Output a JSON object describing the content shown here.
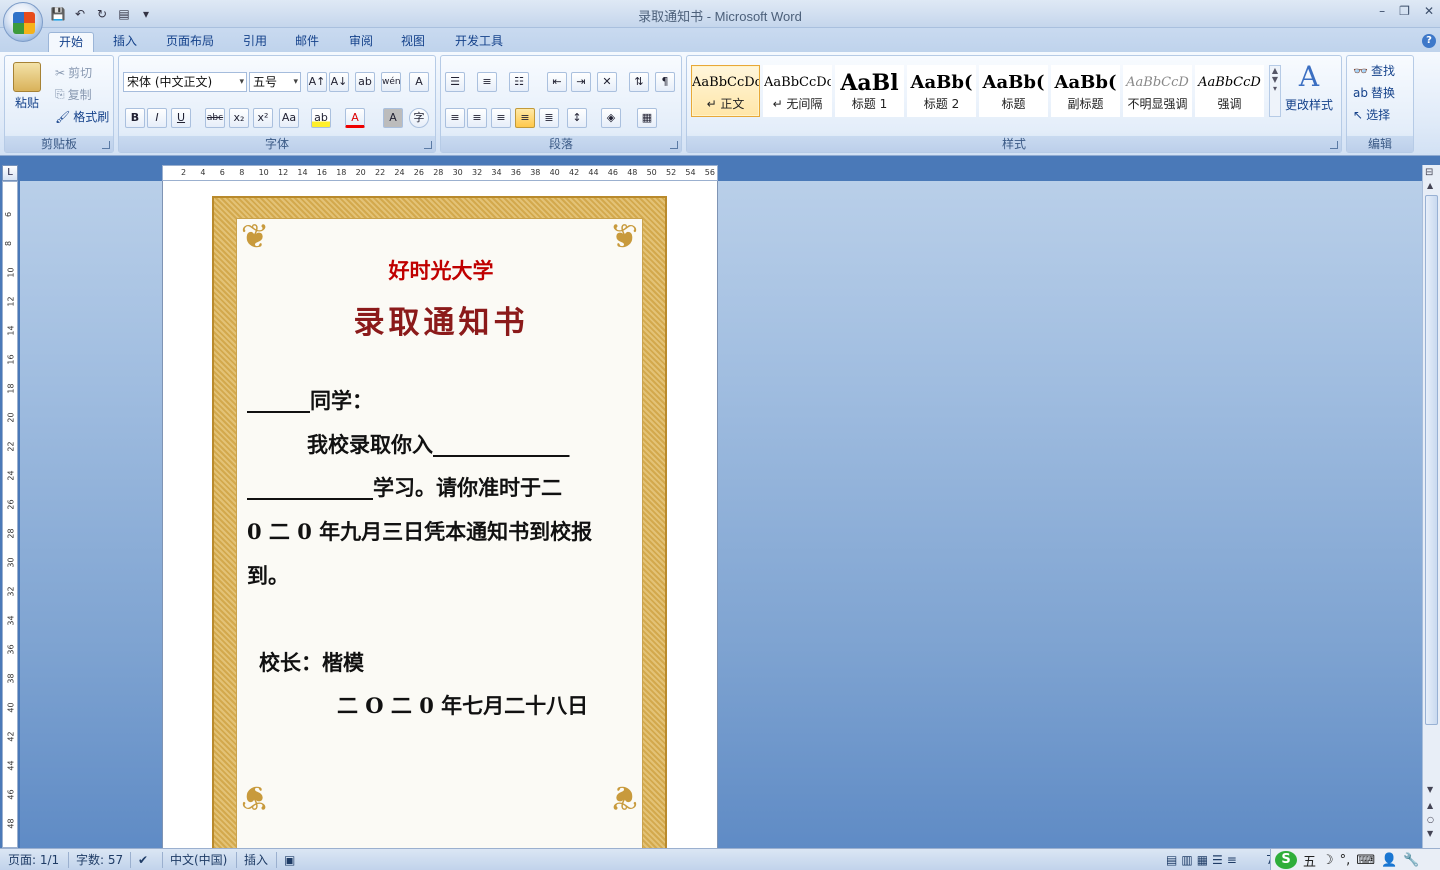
{
  "window": {
    "title": "录取通知书 - Microsoft Word",
    "minimize": "–",
    "restore": "❐",
    "close": "✕"
  },
  "tabs": [
    {
      "label": "开始",
      "active": true
    },
    {
      "label": "插入"
    },
    {
      "label": "页面布局"
    },
    {
      "label": "引用"
    },
    {
      "label": "邮件"
    },
    {
      "label": "审阅"
    },
    {
      "label": "视图"
    },
    {
      "label": "开发工具"
    }
  ],
  "help_label": "?",
  "clipboard": {
    "group": "剪贴板",
    "paste": "粘贴",
    "cut": "剪切",
    "copy": "复制",
    "format_painter": "格式刷"
  },
  "font": {
    "group": "字体",
    "name": "宋体 (中文正文)",
    "size": "五号",
    "bold": "B",
    "italic": "I",
    "underline": "U",
    "strike": "abc",
    "sub": "x₂",
    "sup": "x²",
    "case": "Aa",
    "grow": "A↑",
    "shrink": "A↓",
    "clear": "ab",
    "phonetic": "wén",
    "border": "A",
    "highlight": "ab",
    "color": "A",
    "shade": "A",
    "enclose": "字"
  },
  "paragraph": {
    "group": "段落"
  },
  "styles": {
    "group": "样式",
    "items": [
      {
        "sample": "AaBbCcDc",
        "name": "↵ 正文",
        "selected": true
      },
      {
        "sample": "AaBbCcDc",
        "name": "↵ 无间隔"
      },
      {
        "sample": "AaBl",
        "name": "标题 1"
      },
      {
        "sample": "AaBb(",
        "name": "标题 2"
      },
      {
        "sample": "AaBb(",
        "name": "标题"
      },
      {
        "sample": "AaBb(",
        "name": "副标题"
      },
      {
        "sample": "AaBbCcD",
        "name": "不明显强调"
      },
      {
        "sample": "AaBbCcD",
        "name": "强调"
      }
    ],
    "change": "更改样式"
  },
  "editing": {
    "group": "编辑",
    "find": "查找",
    "replace": "替换",
    "select": "选择"
  },
  "ruler": {
    "h_ticks": [
      "2",
      "4",
      "6",
      "8",
      "10",
      "12",
      "14",
      "16",
      "18",
      "20",
      "22",
      "24",
      "26",
      "28",
      "30",
      "32",
      "34",
      "36",
      "38",
      "40",
      "42",
      "44",
      "46",
      "48",
      "50",
      "52",
      "54",
      "56"
    ],
    "v_ticks": [
      "6",
      "8",
      "10",
      "12",
      "14",
      "16",
      "18",
      "20",
      "22",
      "24",
      "26",
      "28",
      "30",
      "32",
      "34",
      "36",
      "38",
      "40",
      "42",
      "44",
      "46",
      "48"
    ]
  },
  "document": {
    "university": "好时光大学",
    "heading": "录取通知书",
    "salutation": "______同学：",
    "line1": "我校录取你入_____________",
    "line2": "____________学习。请你准时于二",
    "line3": "0 二 0 年九月三日凭本通知书到校报",
    "line4": "到。",
    "signer": "校长：楷模",
    "date": "二 O 二 0 年七月二十八日"
  },
  "status": {
    "page": "页面: 1/1",
    "words": "字数: 57",
    "language": "中文(中国)",
    "mode": "插入",
    "zoom": "7"
  },
  "ime": {
    "brand": "S",
    "mode": "五"
  },
  "colors": {
    "accent": "#15428b",
    "title_red": "#c00000",
    "heading_red": "#8b1a1a",
    "gold": "#d3a94d"
  }
}
